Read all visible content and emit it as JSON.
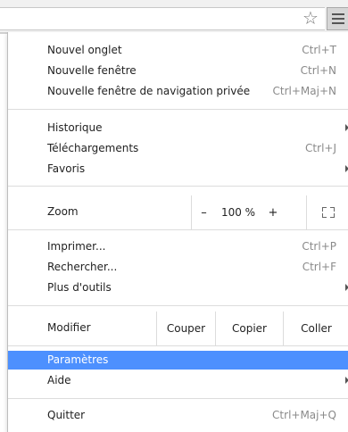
{
  "toolbar": {
    "star_icon": "star-icon",
    "menu_icon": "hamburger-menu-icon"
  },
  "menu": {
    "new_tab": {
      "label": "Nouvel onglet",
      "shortcut": "Ctrl+T"
    },
    "new_window": {
      "label": "Nouvelle fenêtre",
      "shortcut": "Ctrl+N"
    },
    "new_incognito": {
      "label": "Nouvelle fenêtre de navigation privée",
      "shortcut": "Ctrl+Maj+N"
    },
    "history": {
      "label": "Historique"
    },
    "downloads": {
      "label": "Téléchargements",
      "shortcut": "Ctrl+J"
    },
    "bookmarks": {
      "label": "Favoris"
    },
    "zoom": {
      "label": "Zoom",
      "minus": "–",
      "value": "100 %",
      "plus": "+"
    },
    "print": {
      "label": "Imprimer...",
      "shortcut": "Ctrl+P"
    },
    "find": {
      "label": "Rechercher...",
      "shortcut": "Ctrl+F"
    },
    "more_tools": {
      "label": "Plus d'outils"
    },
    "edit": {
      "label": "Modifier",
      "cut": "Couper",
      "copy": "Copier",
      "paste": "Coller"
    },
    "settings": {
      "label": "Paramètres"
    },
    "help": {
      "label": "Aide"
    },
    "quit": {
      "label": "Quitter",
      "shortcut": "Ctrl+Maj+Q"
    }
  },
  "colors": {
    "highlight": "#4d90fe",
    "shortcut_text": "#8a8a8a"
  }
}
